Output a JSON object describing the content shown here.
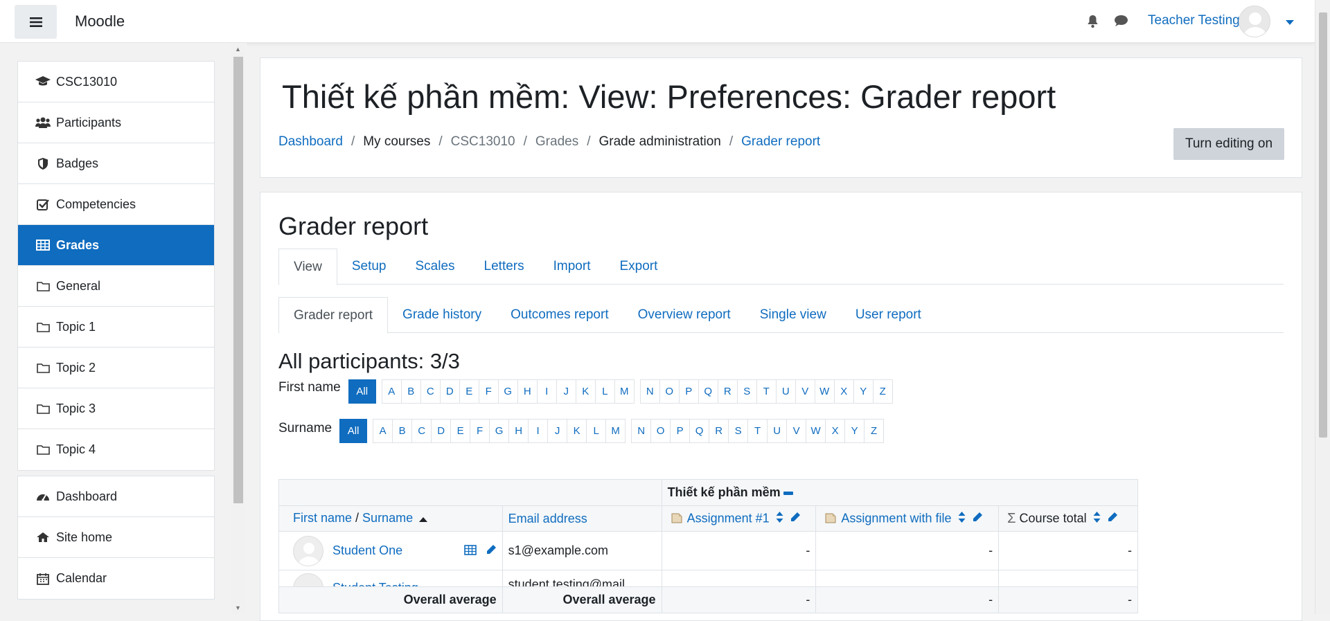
{
  "app": {
    "brand": "Moodle",
    "user_name": "Teacher Testing"
  },
  "drawer": {
    "group1": [
      {
        "label": "CSC13010",
        "icon": "graduation-cap-icon"
      },
      {
        "label": "Participants",
        "icon": "users-icon"
      },
      {
        "label": "Badges",
        "icon": "shield-icon"
      },
      {
        "label": "Competencies",
        "icon": "check-square-icon"
      },
      {
        "label": "Grades",
        "icon": "table-icon",
        "active": true
      },
      {
        "label": "General",
        "icon": "folder-icon"
      },
      {
        "label": "Topic 1",
        "icon": "folder-icon"
      },
      {
        "label": "Topic 2",
        "icon": "folder-icon"
      },
      {
        "label": "Topic 3",
        "icon": "folder-icon"
      },
      {
        "label": "Topic 4",
        "icon": "folder-icon"
      }
    ],
    "group2": [
      {
        "label": "Dashboard",
        "icon": "dashboard-icon"
      },
      {
        "label": "Site home",
        "icon": "home-icon"
      },
      {
        "label": "Calendar",
        "icon": "calendar-icon"
      }
    ]
  },
  "header": {
    "title": "Thiết kế phần mềm: View: Preferences: Grader report",
    "breadcrumb": [
      "Dashboard",
      "My courses",
      "CSC13010",
      "Grades",
      "Grade administration",
      "Grader report"
    ],
    "edit_button": "Turn editing on"
  },
  "main": {
    "heading": "Grader report",
    "tabs": [
      "View",
      "Setup",
      "Scales",
      "Letters",
      "Import",
      "Export"
    ],
    "subtabs": [
      "Grader report",
      "Grade history",
      "Outcomes report",
      "Overview report",
      "Single view",
      "User report"
    ],
    "participants_heading": "All participants: 3/3",
    "first_name_label": "First name",
    "surname_label": "Surname",
    "all_label": "All",
    "letters": [
      "A",
      "B",
      "C",
      "D",
      "E",
      "F",
      "G",
      "H",
      "I",
      "J",
      "K",
      "L",
      "M",
      "N",
      "O",
      "P",
      "Q",
      "R",
      "S",
      "T",
      "U",
      "V",
      "W",
      "X",
      "Y",
      "Z"
    ]
  },
  "grader": {
    "category": "Thiết kế phần mềm",
    "col_first_name": "First name",
    "col_slash": " / ",
    "col_surname": "Surname",
    "col_email": "Email address",
    "col_assign1": "Assignment #1",
    "col_assign2": "Assignment with file",
    "col_total": "Course total",
    "rows": [
      {
        "name": "Student One",
        "email": "s1@example.com",
        "g1": "-",
        "g2": "-",
        "total": "-"
      },
      {
        "name": "Student Testing",
        "email": "student.testing@mail...",
        "g1": "",
        "g2": "",
        "total": ""
      }
    ],
    "overall_label": "Overall average",
    "overall_g1": "-",
    "overall_g2": "-",
    "overall_total": "-"
  }
}
